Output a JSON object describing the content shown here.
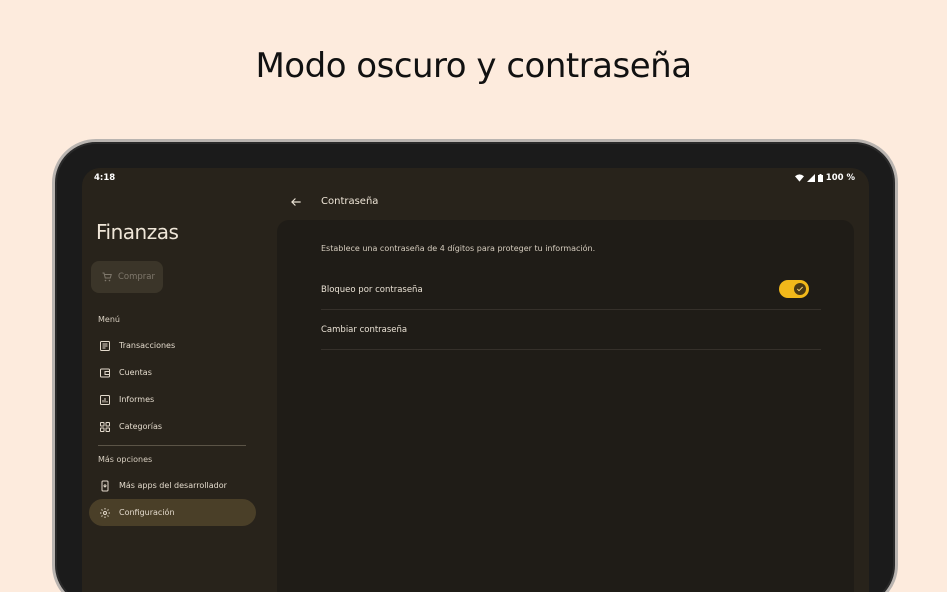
{
  "headline": "Modo oscuro y contraseña",
  "status": {
    "time": "4:18",
    "battery": "100 %"
  },
  "sidebar": {
    "app_title": "Finanzas",
    "buy_label": "Comprar",
    "menu_label": "Menú",
    "items": [
      {
        "label": "Transacciones",
        "icon": "receipt-icon"
      },
      {
        "label": "Cuentas",
        "icon": "wallet-icon"
      },
      {
        "label": "Informes",
        "icon": "bar-chart-icon"
      },
      {
        "label": "Categorías",
        "icon": "grid-icon"
      }
    ],
    "more_label": "Más opciones",
    "more_items": [
      {
        "label": "Más apps del desarrollador",
        "icon": "phone-download-icon"
      },
      {
        "label": "Configuración",
        "icon": "gear-icon",
        "active": true
      }
    ]
  },
  "main": {
    "title": "Contraseña",
    "description": "Establece una contraseña de 4 dígitos para proteger tu información.",
    "rows": [
      {
        "label": "Bloqueo por contraseña",
        "toggle": true
      },
      {
        "label": "Cambiar contraseña"
      }
    ]
  },
  "colors": {
    "accent": "#f2b81a",
    "background": "#fdebdd",
    "screen": "#28231b"
  }
}
